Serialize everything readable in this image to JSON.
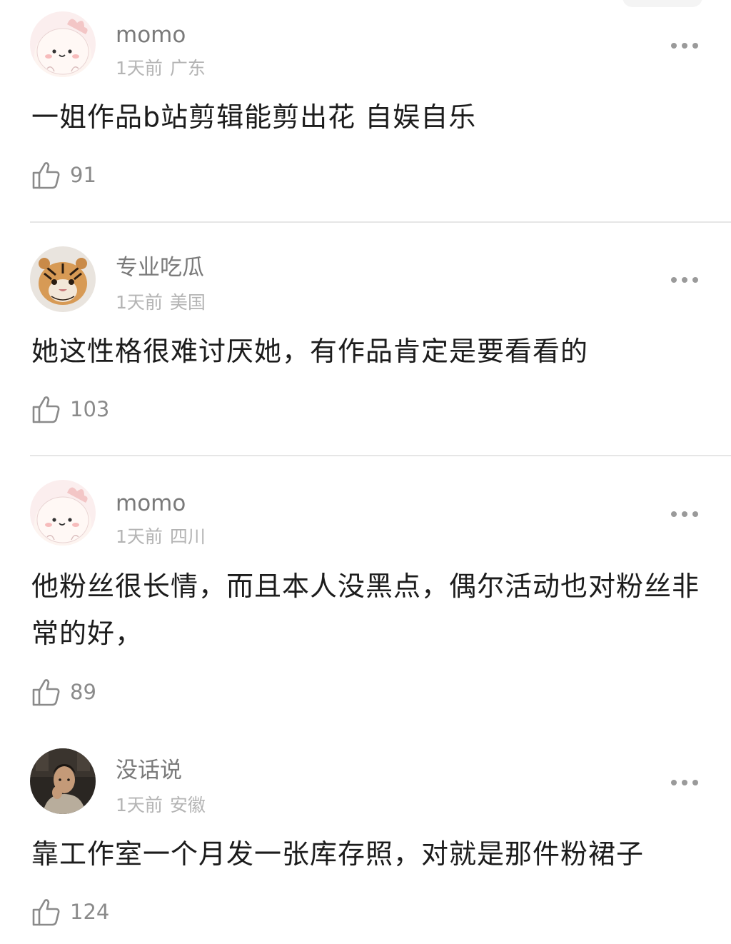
{
  "comments": [
    {
      "username": "momo",
      "time": "1天前",
      "location": "广东",
      "text": "一姐作品b站剪辑能剪出花 自娱自乐",
      "likes": "91",
      "avatar": "pink-cartoon-avatar"
    },
    {
      "username": "专业吃瓜",
      "time": "1天前",
      "location": "美国",
      "text": "她这性格很难讨厌她，有作品肯定是要看看的",
      "likes": "103",
      "avatar": "tiger-cub-avatar"
    },
    {
      "username": "momo",
      "time": "1天前",
      "location": "四川",
      "text": "他粉丝很长情，而且本人没黑点，偶尔活动也对粉丝非常的好，",
      "likes": "89",
      "avatar": "pink-cartoon-avatar"
    },
    {
      "username": "没话说",
      "time": "1天前",
      "location": "安徽",
      "text": "靠工作室一个月发一张库存照，对就是那件粉裙子",
      "likes": "124",
      "avatar": "man-photo-avatar"
    }
  ],
  "colors": {
    "username": "#7a7a7a",
    "meta": "#b4b4b4",
    "text": "#1c1c1c",
    "icon": "#8a8a8a",
    "divider": "#e6e6e6"
  }
}
